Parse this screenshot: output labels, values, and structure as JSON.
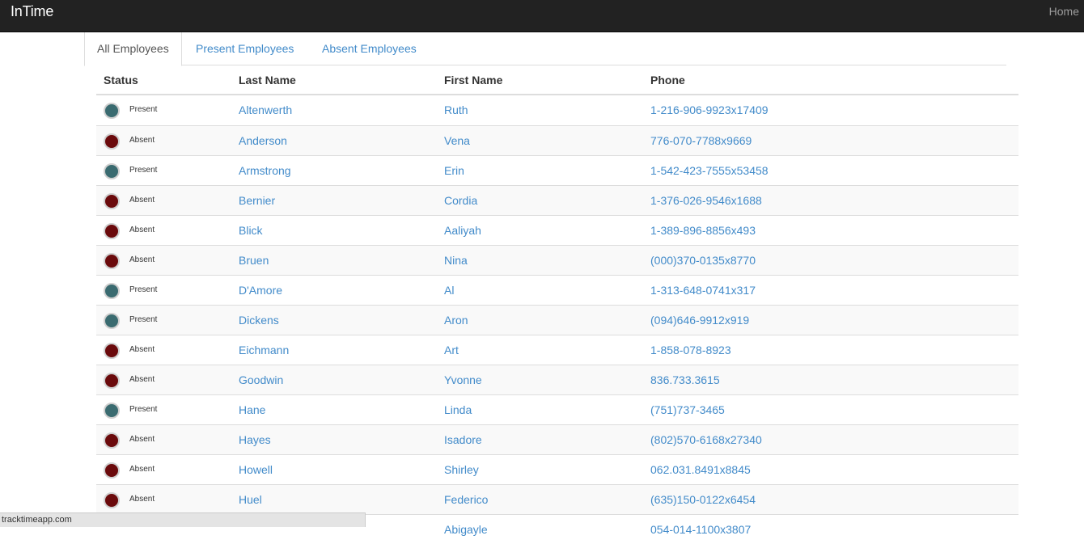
{
  "navbar": {
    "brand": "InTime",
    "home_label": "Home"
  },
  "tabs": [
    {
      "label": "All Employees",
      "active": true
    },
    {
      "label": "Present Employees",
      "active": false
    },
    {
      "label": "Absent Employees",
      "active": false
    }
  ],
  "table": {
    "headers": {
      "status": "Status",
      "last_name": "Last Name",
      "first_name": "First Name",
      "phone": "Phone"
    },
    "status_colors": {
      "Present": "#3a6b70",
      "Absent": "#6b0a0c"
    },
    "rows": [
      {
        "status": "Present",
        "last_name": "Altenwerth",
        "first_name": "Ruth",
        "phone": "1-216-906-9923x17409"
      },
      {
        "status": "Absent",
        "last_name": "Anderson",
        "first_name": "Vena",
        "phone": "776-070-7788x9669"
      },
      {
        "status": "Present",
        "last_name": "Armstrong",
        "first_name": "Erin",
        "phone": "1-542-423-7555x53458"
      },
      {
        "status": "Absent",
        "last_name": "Bernier",
        "first_name": "Cordia",
        "phone": "1-376-026-9546x1688"
      },
      {
        "status": "Absent",
        "last_name": "Blick",
        "first_name": "Aaliyah",
        "phone": "1-389-896-8856x493"
      },
      {
        "status": "Absent",
        "last_name": "Bruen",
        "first_name": "Nina",
        "phone": "(000)370-0135x8770"
      },
      {
        "status": "Present",
        "last_name": "D'Amore",
        "first_name": "Al",
        "phone": "1-313-648-0741x317"
      },
      {
        "status": "Present",
        "last_name": "Dickens",
        "first_name": "Aron",
        "phone": "(094)646-9912x919"
      },
      {
        "status": "Absent",
        "last_name": "Eichmann",
        "first_name": "Art",
        "phone": "1-858-078-8923"
      },
      {
        "status": "Absent",
        "last_name": "Goodwin",
        "first_name": "Yvonne",
        "phone": "836.733.3615"
      },
      {
        "status": "Present",
        "last_name": "Hane",
        "first_name": "Linda",
        "phone": "(751)737-3465"
      },
      {
        "status": "Absent",
        "last_name": "Hayes",
        "first_name": "Isadore",
        "phone": "(802)570-6168x27340"
      },
      {
        "status": "Absent",
        "last_name": "Howell",
        "first_name": "Shirley",
        "phone": "062.031.8491x8845"
      },
      {
        "status": "Absent",
        "last_name": "Huel",
        "first_name": "Federico",
        "phone": "(635)150-0122x6454"
      },
      {
        "status": "",
        "last_name": "",
        "first_name": "Abigayle",
        "phone": "054-014-1100x3807"
      }
    ]
  },
  "statusbar": {
    "text": "tracktimeapp.com"
  }
}
